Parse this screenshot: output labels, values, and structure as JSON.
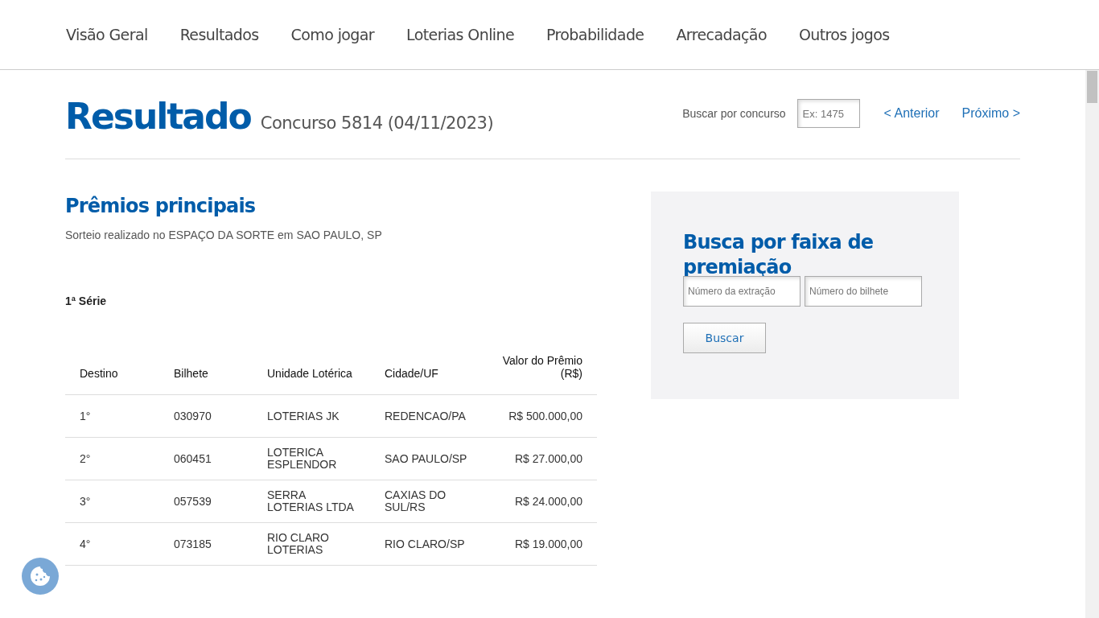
{
  "nav": {
    "items": [
      {
        "label": "Visão Geral"
      },
      {
        "label": "Resultados"
      },
      {
        "label": "Como jogar"
      },
      {
        "label": "Loterias Online"
      },
      {
        "label": "Probabilidade"
      },
      {
        "label": "Arrecadação"
      },
      {
        "label": "Outros jogos"
      }
    ]
  },
  "header": {
    "title": "Resultado",
    "subtitle": "Concurso 5814 (04/11/2023)",
    "search_label": "Buscar por concurso",
    "search": {
      "placeholder": "Ex: 1475"
    },
    "prev": "< Anterior",
    "next": "Próximo >"
  },
  "prizes": {
    "title": "Prêmios principais",
    "description": "Sorteio realizado no ESPAÇO DA SORTE em SAO PAULO, SP",
    "series": "1ª Série",
    "table": {
      "columns": [
        "Destino",
        "Bilhete",
        "Unidade Lotérica",
        "Cidade/UF",
        "Valor do Prêmio (R$)"
      ],
      "rows": [
        {
          "destino": "1°",
          "bilhete": "030970",
          "unidade": "LOTERIAS JK",
          "cidade": "REDENCAO/PA",
          "valor": "R$ 500.000,00"
        },
        {
          "destino": "2°",
          "bilhete": "060451",
          "unidade": "LOTERICA ESPLENDOR",
          "cidade": "SAO PAULO/SP",
          "valor": "R$ 27.000,00"
        },
        {
          "destino": "3°",
          "bilhete": "057539",
          "unidade": "SERRA LOTERIAS LTDA",
          "cidade": "CAXIAS DO SUL/RS",
          "valor": "R$ 24.000,00"
        },
        {
          "destino": "4°",
          "bilhete": "073185",
          "unidade": "RIO CLARO LOTERIAS",
          "cidade": "RIO CLARO/SP",
          "valor": "R$ 19.000,00"
        }
      ]
    }
  },
  "faixa": {
    "title": "Busca por faixa de premiação",
    "fields": [
      {
        "placeholder": "Número da extração"
      },
      {
        "placeholder": "Número do bilhete"
      }
    ],
    "button": "Buscar"
  }
}
